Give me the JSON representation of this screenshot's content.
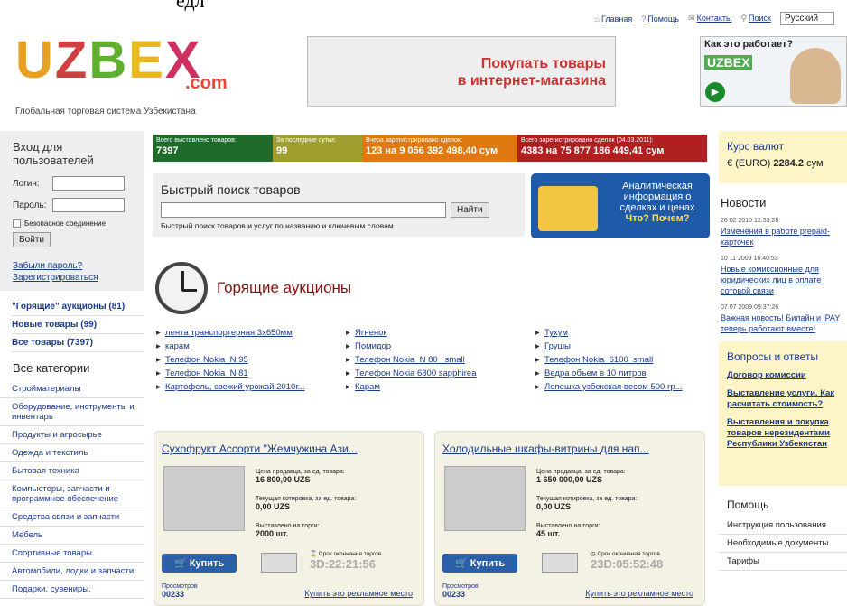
{
  "header": {
    "title_fragment": "едл",
    "links": [
      "Главная",
      "Помощь",
      "Контакты",
      "Поиск"
    ],
    "icons": [
      "home-icon",
      "help-icon",
      "mail-icon",
      "search-icon"
    ],
    "language": "Русский"
  },
  "logo": {
    "text": "UZBEX",
    "com": ".com",
    "tagline": "Глобальная торговая система Узбекистана",
    "letters": [
      {
        "c": "U",
        "color": "#e8a020"
      },
      {
        "c": "Z",
        "color": "#d04040"
      },
      {
        "c": "B",
        "color": "#60b030"
      },
      {
        "c": "E",
        "color": "#e8b820"
      },
      {
        "c": "X",
        "color": "#d03060"
      }
    ]
  },
  "banner": {
    "line1": "Покупать товары",
    "line2": "в интернет-магазина"
  },
  "promo": {
    "title": "Как это работает?",
    "mini": "UZBEX"
  },
  "login": {
    "title": "Вход для пользователей",
    "login_label": "Логин:",
    "password_label": "Пароль:",
    "secure": "Безопасное соединение",
    "button": "Войти",
    "forgot": "Забыли пароль?",
    "register": "Зарегистрироваться"
  },
  "quick": [
    "\"Горящие\" аукционы (81)",
    "Новые товары (99)",
    "Все товары (7397)"
  ],
  "categories": {
    "title": "Все категории",
    "items": [
      "Стройматериалы",
      "Оборудование, инструменты и инвентарь",
      "Продукты и агросырье",
      "Одежда и текстиль",
      "Бытовая техника",
      "Компьютеры, запчасти и программное обеспечение",
      "Средства связи и запчасти",
      "Мебель",
      "Спортивные товары",
      "Автомобили, лодки и запчасти",
      "Подарки, сувениры,"
    ]
  },
  "stats": [
    {
      "label": "Всего выставлено товаров:",
      "value": "7397",
      "color": "#1f6b2a"
    },
    {
      "label": "За последние сутки:",
      "value": "99",
      "color": "#a0a030"
    },
    {
      "label": "Вчера зарегистрировано сделок:",
      "value": "123 на 9 056 392 498,40 сум",
      "color": "#e07a10"
    },
    {
      "label": "Всего зарегистрировано сделок (04.03.2011):",
      "value": "4383 на 75 877 186 449,41 сум",
      "color": "#b02020"
    }
  ],
  "search": {
    "title": "Быстрый поиск товаров",
    "button": "Найти",
    "hint": "Быстрый поиск товаров и услуг по названию и ключевым словам"
  },
  "analytics": {
    "text": "Аналитическая информация о сделках и ценах",
    "cta": "Что? Почем?"
  },
  "hot": {
    "title": "Горящие аукционы",
    "items": [
      "лента транспортерная 3х650мм",
      "Ягненок",
      "Тухум",
      "карам",
      "Помидор",
      "Грушы",
      "Телефон Nokia_N 95",
      "Телефон Nokia_N 80 _small",
      "Телефон Nokia_6100_small",
      "Телефон Nokia_N 81",
      "Телефон Nokia 6800 sapphirea",
      "Ведра объем в 10 литров",
      "Картофель, свежий урожай 2010г...",
      "Карам",
      "Лепешка узбекская весом 500 гр..."
    ]
  },
  "cards": [
    {
      "title": "Сухофрукт Ассорти \"Жемчужина Ази...",
      "price_label": "Цена продавца, за ед. товара:",
      "price": "16 800,00 UZS",
      "quote_label": "Текущая котировка, за ед. товара:",
      "quote": "0,00 UZS",
      "stock_label": "Выставлено на торги:",
      "stock": "2000 шт.",
      "buy": "Купить",
      "end_label": "Срок окончания торгов",
      "timer": "3D:22:21:56",
      "views_label": "Просмотров",
      "views": "00233",
      "ad": "Купить это рекламное место"
    },
    {
      "title": "Холодильные шкафы-витрины для нап...",
      "price_label": "Цена продавца, за ед. товара:",
      "price": "1 650 000,00 UZS",
      "quote_label": "Текущая котировка, за ед. товара:",
      "quote": "0,00 UZS",
      "stock_label": "Выставлено на торги:",
      "stock": "45 шт.",
      "buy": "Купить",
      "end_label": "Срок окончания торгов",
      "timer": "23D:05:52:48",
      "views_label": "Просмотров",
      "views": "00233",
      "ad": "Купить это рекламное место"
    }
  ],
  "currency": {
    "title": "Курс валют",
    "symbol": "€",
    "value_label": "(EURO)",
    "value": "2284.2",
    "unit": "сум"
  },
  "news": {
    "title": "Новости",
    "items": [
      {
        "date": "26 02 2010 12:53:28",
        "text": "Изменения в работе prepaid-карточек"
      },
      {
        "date": "10 11 2009 16:40:53",
        "text": "Новые комиссионные для юридических лиц в оплате сотовой связи"
      },
      {
        "date": "07 07 2009 09:37:26",
        "text": "Важная новость! Билайн и iPAY теперь работают вместе!"
      }
    ]
  },
  "qa": {
    "title": "Вопросы и ответы",
    "items": [
      "Договор комиссии",
      "Выставление услуги. Как расчитать стоимость?",
      "Выставления и покупка товаров нерезидентами Республики Узбекистан"
    ]
  },
  "help": {
    "title": "Помощь",
    "items": [
      "Инструкция пользования",
      "Необходимые документы",
      "Тарифы"
    ]
  }
}
